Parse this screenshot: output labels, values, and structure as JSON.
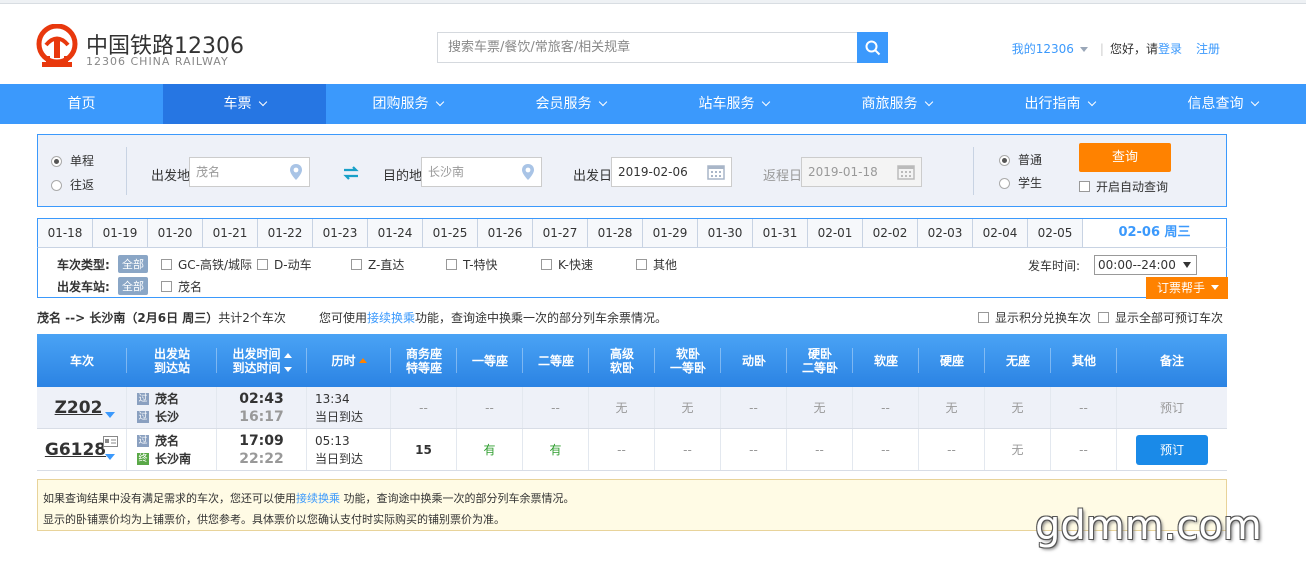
{
  "header": {
    "brand_title": "中国铁路12306",
    "brand_sub": "12306 CHINA RAILWAY",
    "search_placeholder": "搜索车票/餐饮/常旅客/相关规章",
    "my_account": "我的12306",
    "greeting": "您好，请",
    "login": "登录",
    "register": "注册"
  },
  "nav": [
    {
      "label": "首页",
      "chevron": false
    },
    {
      "label": "车票",
      "chevron": true
    },
    {
      "label": "团购服务",
      "chevron": true
    },
    {
      "label": "会员服务",
      "chevron": true
    },
    {
      "label": "站车服务",
      "chevron": true
    },
    {
      "label": "商旅服务",
      "chevron": true
    },
    {
      "label": "出行指南",
      "chevron": true
    },
    {
      "label": "信息查询",
      "chevron": true
    }
  ],
  "query": {
    "trip_one_way": "单程",
    "trip_round": "往返",
    "from_label": "出发地",
    "from_value": "茂名",
    "to_label": "目的地",
    "to_value": "长沙南",
    "depart_label": "出发日",
    "depart_value": "2019-02-06",
    "return_label": "返程日",
    "return_value": "2019-01-18",
    "type_normal": "普通",
    "type_student": "学生",
    "search_button": "查询",
    "auto_query": "开启自动查询"
  },
  "dates": [
    "01-18",
    "01-19",
    "01-20",
    "01-21",
    "01-22",
    "01-23",
    "01-24",
    "01-25",
    "01-26",
    "01-27",
    "01-28",
    "01-29",
    "01-30",
    "01-31",
    "02-01",
    "02-02",
    "02-03",
    "02-04",
    "02-05"
  ],
  "active_date": "02-06 周三",
  "filters": {
    "type_title": "车次类型:",
    "all": "全部",
    "types": [
      "GC-高铁/城际",
      "D-动车",
      "Z-直达",
      "T-特快",
      "K-快速",
      "其他"
    ],
    "station_title": "出发车站:",
    "stations": [
      "茂名"
    ],
    "time_title": "发车时间:",
    "time_value": "00:00--24:00",
    "helper": "订票帮手"
  },
  "summary": {
    "route": "茂名 --> 长沙南（2月6日  周三）",
    "count": "共计2个车次",
    "tip_pre": "您可使用",
    "tip_link": "接续换乘",
    "tip_post": "功能，查询途中换乘一次的部分列车余票情况。",
    "opt_points": "显示积分兑换车次",
    "opt_all": "显示全部可预订车次"
  },
  "table_headers": [
    {
      "l1": "车次",
      "l2": ""
    },
    {
      "l1": "出发站",
      "l2": "到达站"
    },
    {
      "l1": "出发时间",
      "l2": "到达时间"
    },
    {
      "l1": "历时",
      "l2": ""
    },
    {
      "l1": "商务座",
      "l2": "特等座"
    },
    {
      "l1": "一等座",
      "l2": ""
    },
    {
      "l1": "二等座",
      "l2": ""
    },
    {
      "l1": "高级",
      "l2": "软卧"
    },
    {
      "l1": "软卧",
      "l2": "一等卧"
    },
    {
      "l1": "动卧",
      "l2": ""
    },
    {
      "l1": "硬卧",
      "l2": "二等卧"
    },
    {
      "l1": "软座",
      "l2": ""
    },
    {
      "l1": "硬座",
      "l2": ""
    },
    {
      "l1": "无座",
      "l2": ""
    },
    {
      "l1": "其他",
      "l2": ""
    },
    {
      "l1": "备注",
      "l2": ""
    }
  ],
  "trains": [
    {
      "train_no": "Z202",
      "from_badge": "过",
      "from": "茂名",
      "to_badge": "过",
      "to": "长沙",
      "dep": "02:43",
      "arr": "16:17",
      "duration": "13:34",
      "arrive_day": "当日到达",
      "seats": [
        "--",
        "--",
        "--",
        "无",
        "无",
        "--",
        "无",
        "--",
        "无",
        "无",
        "--"
      ],
      "action": "预订"
    },
    {
      "train_no": "G6128",
      "from_badge": "过",
      "from": "茂名",
      "to_badge": "终",
      "to": "长沙南",
      "dep": "17:09",
      "arr": "22:22",
      "duration": "05:13",
      "arrive_day": "当日到达",
      "seats": [
        "15",
        "有",
        "有",
        "--",
        "--",
        "--",
        "--",
        "--",
        "--",
        "无",
        "--"
      ],
      "action": "预订"
    }
  ],
  "notes": {
    "line1_pre": "如果查询结果中没有满足需求的车次，您还可以使用",
    "line1_link": "接续换乘",
    "line1_post": " 功能，查询途中换乘一次的部分列车余票情况。",
    "line2": "显示的卧铺票价均为上铺票价，供您参考。具体票价以您确认支付时实际购买的铺别票价为准。"
  },
  "watermark": "gdmm.com",
  "colors": {
    "brand_blue": "#3b99fc",
    "nav_active": "#2676e3",
    "orange": "#ff8200",
    "available_green": "#2d9d2d"
  }
}
